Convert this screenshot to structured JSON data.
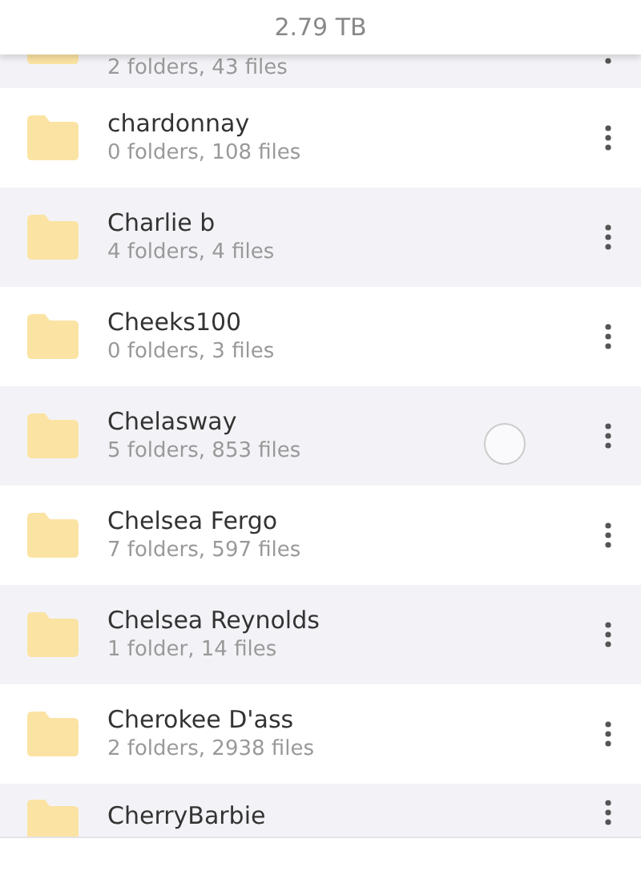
{
  "header": {
    "storage": "2.79 TB"
  },
  "folders": [
    {
      "details": "2 folders, 43 files"
    },
    {
      "name": "chardonnay",
      "details": "0 folders, 108 files"
    },
    {
      "name": "Charlie b",
      "details": "4 folders, 4 files"
    },
    {
      "name": "Cheeks100",
      "details": "0 folders, 3 files"
    },
    {
      "name": "Chelasway",
      "details": "5 folders, 853 files",
      "touched": true
    },
    {
      "name": "Chelsea Fergo",
      "details": "7 folders, 597 files"
    },
    {
      "name": "Chelsea Reynolds",
      "details": "1 folder, 14 files"
    },
    {
      "name": "Cherokee D'ass",
      "details": "2 folders, 2938 files"
    },
    {
      "name": "CherryBarbie"
    }
  ]
}
